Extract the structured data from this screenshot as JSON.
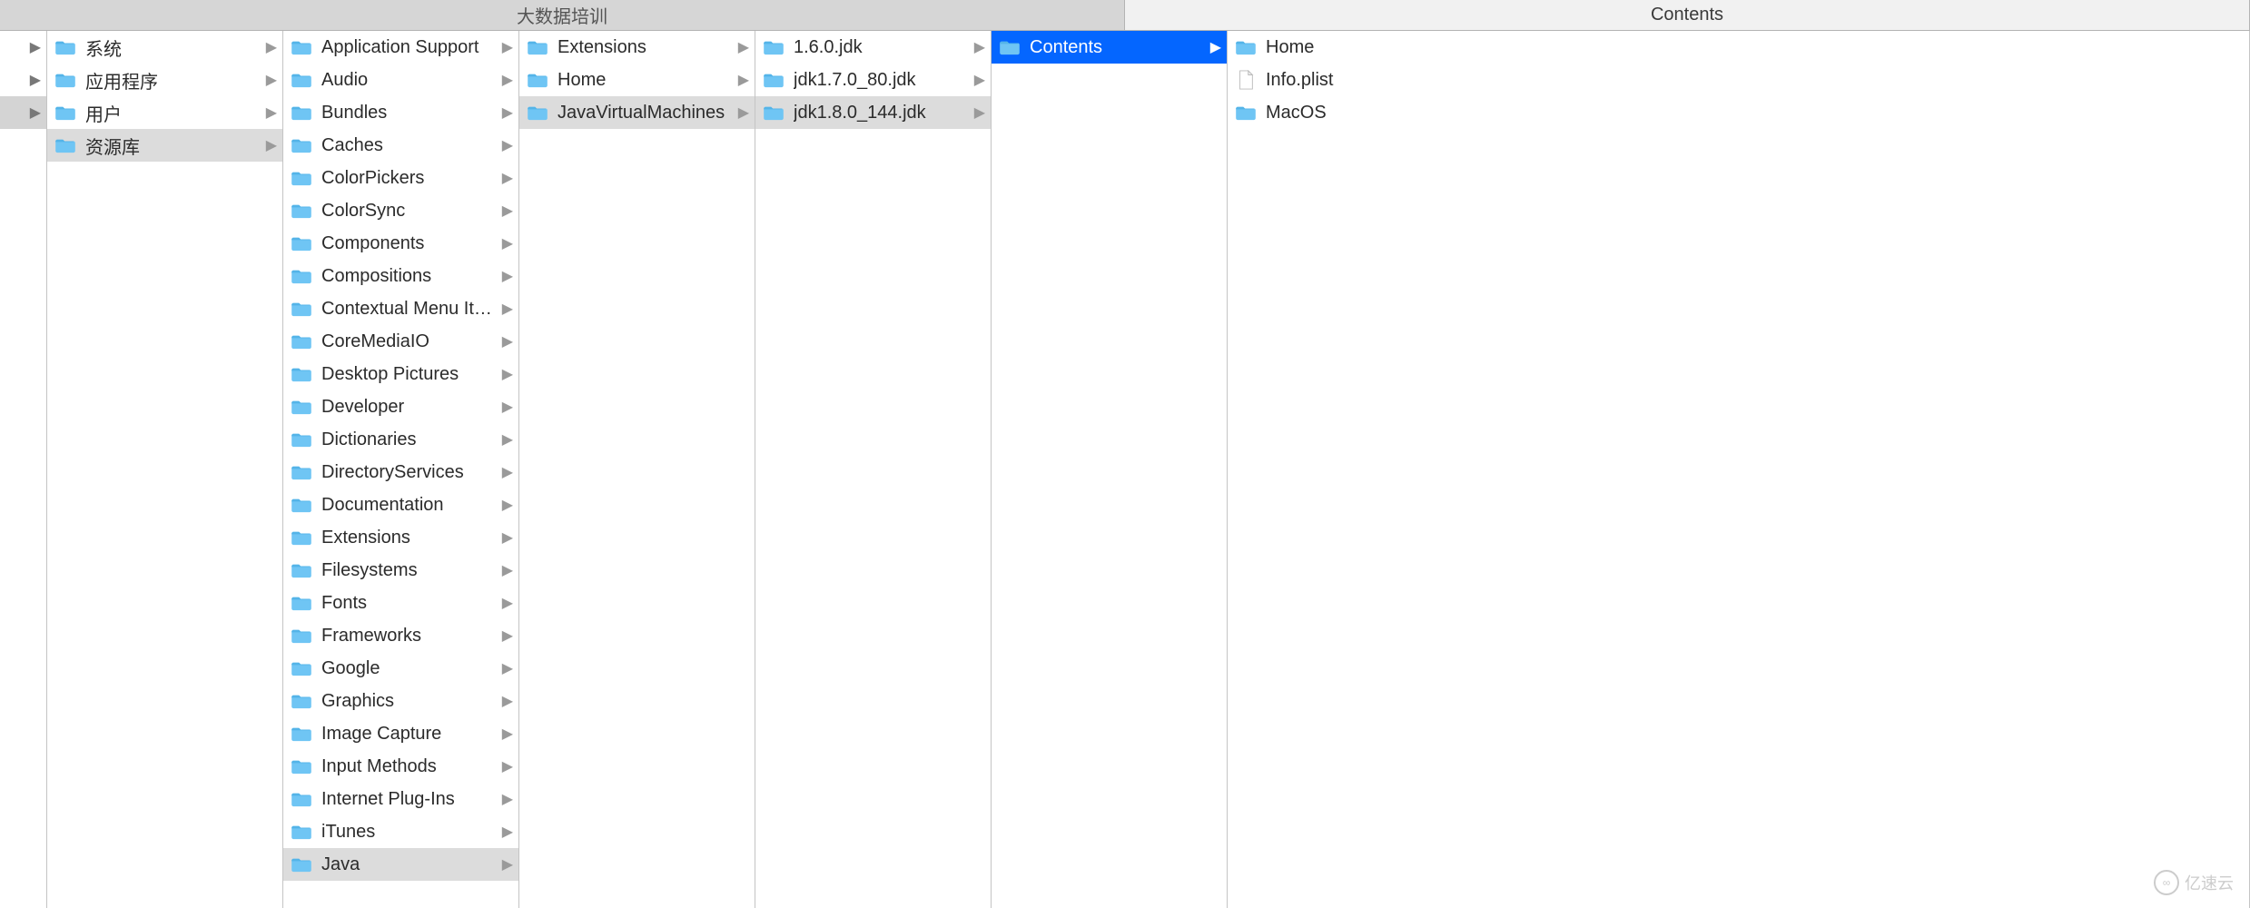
{
  "tabs": [
    {
      "label": "大数据培训",
      "active": true
    },
    {
      "label": "Contents",
      "active": false
    }
  ],
  "columns": {
    "c0": [
      {
        "arrow": true,
        "selected": false
      },
      {
        "arrow": true,
        "selected": false
      },
      {
        "arrow": true,
        "selected": true
      }
    ],
    "c1": [
      {
        "label": "系统",
        "icon": "folder-x",
        "hasChildren": true,
        "selected": false
      },
      {
        "label": "应用程序",
        "icon": "folder-a",
        "hasChildren": true,
        "selected": false
      },
      {
        "label": "用户",
        "icon": "folder-user",
        "hasChildren": true,
        "selected": false
      },
      {
        "label": "资源库",
        "icon": "folder",
        "hasChildren": true,
        "selected": "grey"
      }
    ],
    "c2": [
      {
        "label": "Application Support",
        "icon": "folder",
        "hasChildren": true
      },
      {
        "label": "Audio",
        "icon": "folder",
        "hasChildren": true
      },
      {
        "label": "Bundles",
        "icon": "folder",
        "hasChildren": true
      },
      {
        "label": "Caches",
        "icon": "folder",
        "hasChildren": true
      },
      {
        "label": "ColorPickers",
        "icon": "folder",
        "hasChildren": true
      },
      {
        "label": "ColorSync",
        "icon": "folder",
        "hasChildren": true
      },
      {
        "label": "Components",
        "icon": "folder",
        "hasChildren": true
      },
      {
        "label": "Compositions",
        "icon": "folder",
        "hasChildren": true
      },
      {
        "label": "Contextual Menu Items",
        "icon": "folder",
        "hasChildren": true
      },
      {
        "label": "CoreMediaIO",
        "icon": "folder",
        "hasChildren": true
      },
      {
        "label": "Desktop Pictures",
        "icon": "folder",
        "hasChildren": true
      },
      {
        "label": "Developer",
        "icon": "folder",
        "hasChildren": true
      },
      {
        "label": "Dictionaries",
        "icon": "folder",
        "hasChildren": true
      },
      {
        "label": "DirectoryServices",
        "icon": "folder",
        "hasChildren": true
      },
      {
        "label": "Documentation",
        "icon": "folder",
        "hasChildren": true
      },
      {
        "label": "Extensions",
        "icon": "folder",
        "hasChildren": true
      },
      {
        "label": "Filesystems",
        "icon": "folder",
        "hasChildren": true
      },
      {
        "label": "Fonts",
        "icon": "folder",
        "hasChildren": true
      },
      {
        "label": "Frameworks",
        "icon": "folder",
        "hasChildren": true
      },
      {
        "label": "Google",
        "icon": "folder",
        "hasChildren": true
      },
      {
        "label": "Graphics",
        "icon": "folder",
        "hasChildren": true
      },
      {
        "label": "Image Capture",
        "icon": "folder",
        "hasChildren": true
      },
      {
        "label": "Input Methods",
        "icon": "folder",
        "hasChildren": true
      },
      {
        "label": "Internet Plug-Ins",
        "icon": "folder",
        "hasChildren": true
      },
      {
        "label": "iTunes",
        "icon": "folder",
        "hasChildren": true
      },
      {
        "label": "Java",
        "icon": "folder",
        "hasChildren": true,
        "selected": "grey"
      }
    ],
    "c3": [
      {
        "label": "Extensions",
        "icon": "folder",
        "hasChildren": true
      },
      {
        "label": "Home",
        "icon": "folder-alias",
        "hasChildren": true
      },
      {
        "label": "JavaVirtualMachines",
        "icon": "folder",
        "hasChildren": true,
        "selected": "grey"
      }
    ],
    "c4": [
      {
        "label": "1.6.0.jdk",
        "icon": "folder",
        "hasChildren": true
      },
      {
        "label": "jdk1.7.0_80.jdk",
        "icon": "folder",
        "hasChildren": true
      },
      {
        "label": "jdk1.8.0_144.jdk",
        "icon": "folder",
        "hasChildren": true,
        "selected": "grey"
      }
    ],
    "c5": [
      {
        "label": "Contents",
        "icon": "folder",
        "hasChildren": true,
        "selected": "blue"
      }
    ],
    "c6": [
      {
        "label": "Home",
        "icon": "folder",
        "hasChildren": false
      },
      {
        "label": "Info.plist",
        "icon": "file",
        "hasChildren": false
      },
      {
        "label": "MacOS",
        "icon": "folder",
        "hasChildren": false
      }
    ]
  },
  "watermark": "亿速云"
}
